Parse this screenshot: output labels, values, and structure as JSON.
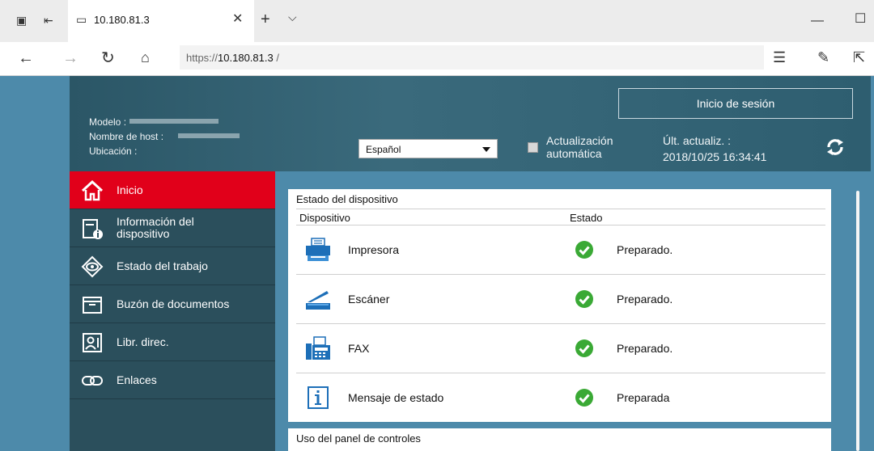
{
  "browser": {
    "tab_title": "10.180.81.3",
    "url_prefix": "https://",
    "url_host": "10.180.81.3",
    "url_suffix": " /"
  },
  "header": {
    "model_label": "Modelo :",
    "host_label": "Nombre de host :",
    "location_label": "Ubicación :",
    "language": "Español",
    "auto_update_line1": "Actualización",
    "auto_update_line2": "automática",
    "last_update_label": "Últ. actualiz. :",
    "last_update_value": "2018/10/25 16:34:41",
    "login_label": "Inicio de sesión"
  },
  "sidebar": {
    "items": [
      {
        "label": "Inicio",
        "icon": "home-icon",
        "active": true
      },
      {
        "label_line1": "Información del",
        "label_line2": "dispositivo",
        "icon": "device-info-icon"
      },
      {
        "label": "Estado del trabajo",
        "icon": "eye-icon"
      },
      {
        "label": "Buzón de documentos",
        "icon": "folder-icon"
      },
      {
        "label": "Libr. direc.",
        "icon": "address-book-icon"
      },
      {
        "label": "Enlaces",
        "icon": "link-icon"
      }
    ]
  },
  "device_status": {
    "title": "Estado del dispositivo",
    "col_device": "Dispositivo",
    "col_state": "Estado",
    "rows": [
      {
        "name": "Impresora",
        "state": "Preparado.",
        "icon": "printer-icon"
      },
      {
        "name": "Escáner",
        "state": "Preparado.",
        "icon": "scanner-icon"
      },
      {
        "name": "FAX",
        "state": "Preparado.",
        "icon": "fax-icon"
      },
      {
        "name": "Mensaje de estado",
        "state": "Preparada",
        "icon": "info-icon"
      }
    ]
  },
  "panel_usage": {
    "title": "Uso del panel de controles"
  },
  "colors": {
    "accent_red": "#e1001a",
    "sidebar_bg": "#2b4f5c",
    "page_bg": "#4d8aaa",
    "ok_green": "#3aa935"
  }
}
